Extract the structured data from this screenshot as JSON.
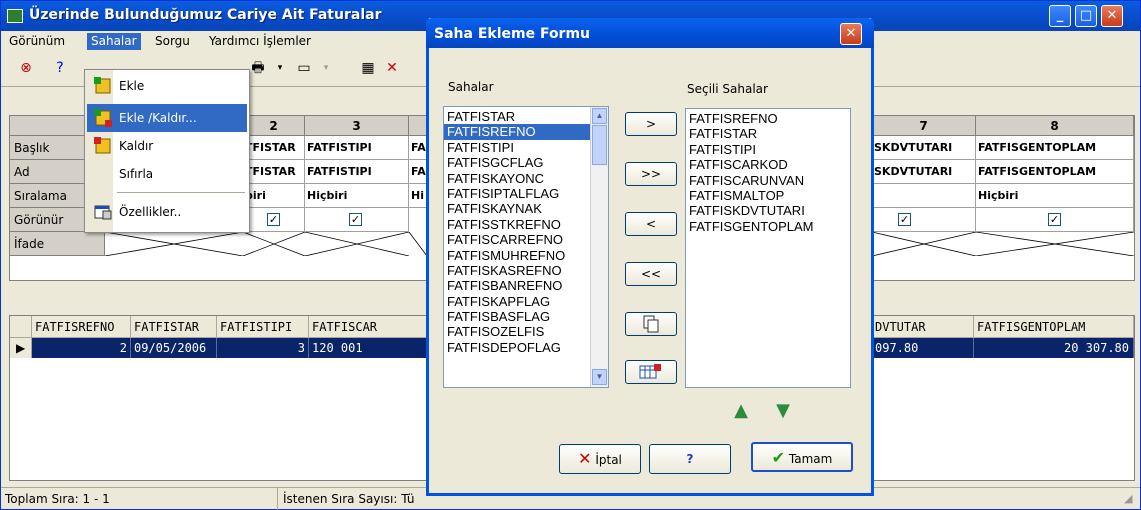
{
  "main_window": {
    "title": "Üzerinde Bulunduğumuz Cariye Ait Faturalar"
  },
  "menubar": [
    "Görünüm",
    "Sahalar",
    "Sorgu",
    "Yardımcı İşlemler"
  ],
  "sahalar_menu": [
    {
      "label": "Ekle",
      "icon": "add-field-icon"
    },
    {
      "label": "Ekle /Kaldır...",
      "icon": "add-remove-icon"
    },
    {
      "label": "Kaldır",
      "icon": "remove-field-icon"
    },
    {
      "label": "Sıfırla",
      "icon": ""
    },
    {
      "label": "Özellikler..",
      "icon": "properties-icon"
    }
  ],
  "field_grid": {
    "col_headers": [
      "2",
      "3",
      "7",
      "8"
    ],
    "row_labels": [
      "Başlık",
      "Ad",
      "Sıralama",
      "Görünür",
      "İfade"
    ],
    "col2": {
      "baslik": "TFISTAR",
      "ad": "TFISTAR",
      "siralama": "biri"
    },
    "col3": {
      "baslik": "FATFISTIPI",
      "ad": "FATFISTIPI",
      "siralama": "Hiçbiri",
      "next": "FA",
      "next_sira": "Hi"
    },
    "col7": {
      "baslik": "SKDVTUTARI",
      "ad": "SKDVTUTARI"
    },
    "col8": {
      "baslik": "FATFISGENTOPLAM",
      "ad": "FATFISGENTOPLAM",
      "siralama": "Hiçbiri"
    }
  },
  "data_grid": {
    "headers": [
      "FATFISREFNO",
      "FATFISTAR",
      "FATFISTIPI",
      "FATFISCAR",
      "DVTUTAR",
      "FATFISGENTOPLAM"
    ],
    "row": [
      "2",
      "09/05/2006",
      "3",
      "120 001",
      "097.80",
      "20 307.80"
    ]
  },
  "status": {
    "left": "Toplam Sıra: 1 - 1",
    "mid": "İstenen Sıra Sayısı: Tü"
  },
  "dialog": {
    "title": "Saha Ekleme Formu",
    "left_label": "Sahalar",
    "right_label": "Seçili Sahalar",
    "left_items": [
      "FATFISTAR",
      "FATFISREFNO",
      "FATFISTIPI",
      "FATFISGCFLAG",
      "FATFISKAYONC",
      "FATFISIPTALFLAG",
      "FATFISKAYNAK",
      "FATFISSTKREFNO",
      "FATFISCARREFNO",
      "FATFISMUHREFNO",
      "FATFISKASREFNO",
      "FATFISBANREFNO",
      "FATFISKAPFLAG",
      "FATFISBASFLAG",
      "FATFISOZELFIS",
      "FATFISDEPOFLAG"
    ],
    "right_items": [
      "FATFISREFNO",
      "FATFISTAR",
      "FATFISTIPI",
      "FATFISCARKOD",
      "FATFISCARUNVAN",
      "FATFISMALTOP",
      "FATFISKDVTUTARI",
      "FATFISGENTOPLAM"
    ],
    "move_buttons": [
      ">",
      ">>",
      "<",
      "<<"
    ],
    "cancel_label": "İptal",
    "help_label": "?",
    "ok_label": "Tamam"
  }
}
